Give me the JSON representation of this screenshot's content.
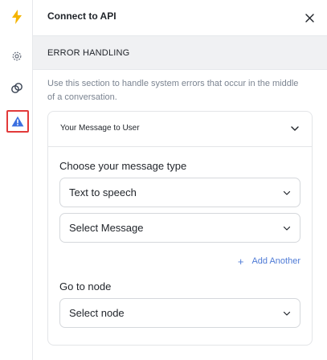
{
  "header": {
    "title": "Connect to API"
  },
  "section": {
    "title": "ERROR HANDLING"
  },
  "description": "Use this section to handle system errors that occur in the middle of a conversation.",
  "card": {
    "title": "Your Message to User",
    "message_type_label": "Choose your message type",
    "message_type_value": "Text to speech",
    "message_select_value": "Select Message",
    "add_another_label": "Add Another",
    "add_another_icon": "+",
    "go_to_node_label": "Go to node",
    "node_select_value": "Select node"
  },
  "colors": {
    "accent_link": "#4f7bd6",
    "bolt": "#f5b400",
    "warning_icon": "#3b6fe0",
    "highlight_border": "#e23a3a"
  }
}
